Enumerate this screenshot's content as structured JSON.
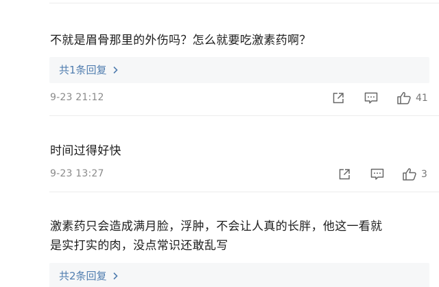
{
  "comments": [
    {
      "text": "不就是眉骨那里的外伤吗？怎么就要吃激素药啊？",
      "reply_label": "共1条回复",
      "time": "9-23 21:12",
      "likes": "41"
    },
    {
      "text": "时间过得好快",
      "time": "9-23 13:27",
      "likes": "3"
    },
    {
      "text_line1": "激素药只会造成满月脸，浮肿，不会让人真的长胖，他这一看就",
      "text_line2": "是实打实的肉，没点常识还敢乱写",
      "reply_label": "共2条回复"
    }
  ],
  "icons": {
    "share": "share-icon",
    "comment": "comment-icon",
    "like": "thumbs-up-icon",
    "chevron": "chevron-right-icon"
  },
  "colors": {
    "link": "#507daf",
    "meta": "#8a8a8a",
    "reply_bg": "#f6f7f8"
  }
}
